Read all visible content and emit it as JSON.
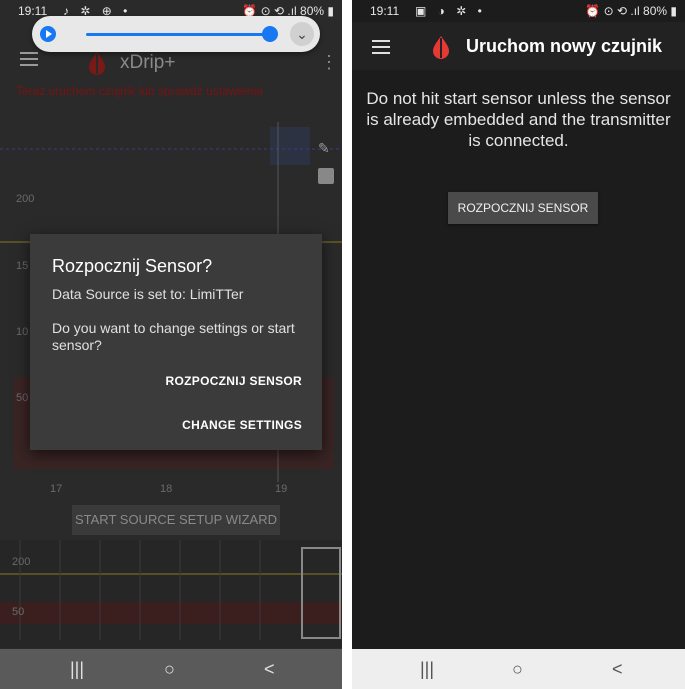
{
  "left_screen": {
    "status": {
      "time": "19:11",
      "icons": "♪ ✲ ⊕ •",
      "right": "⏰ ⊙ ⟲ .ıl 80% ▮"
    },
    "media": {
      "play_icon": "play-icon",
      "chevron_icon": "chevron-down-icon"
    },
    "app": {
      "title": "xDrip+",
      "menu_icon": "hamburger-icon",
      "overflow_icon": "overflow-menu-icon",
      "warning_text": "Teraz uruchom czujnik lub sprawdź ustawienia"
    },
    "chart": {
      "y_labels": [
        "200",
        "15",
        "10",
        "50"
      ],
      "x_labels": [
        "17",
        "18",
        "19"
      ],
      "mini_y_labels": [
        "200",
        "50"
      ]
    },
    "wizard_button": "START SOURCE SETUP WIZARD",
    "dialog": {
      "title": "Rozpocznij Sensor?",
      "line1": "Data Source is set to: LimiTTer",
      "line2": "Do you want to change settings or start sensor?",
      "button_start": "ROZPOCZNIJ SENSOR",
      "button_settings": "CHANGE SETTINGS"
    },
    "nav": {
      "recents": "|||",
      "home": "○",
      "back": "<"
    }
  },
  "right_screen": {
    "status": {
      "time": "19:11",
      "icons": "▣ ◑ ✲ •",
      "right": "⏰ ⊙ ⟲ .ıl 80% ▮"
    },
    "toolbar": {
      "title": "Uruchom nowy czujnik",
      "menu_icon": "hamburger-icon"
    },
    "message": "Do not hit start sensor unless the sensor is already embedded and the transmitter is connected.",
    "start_button": "ROZPOCZNIJ SENSOR",
    "nav": {
      "recents": "|||",
      "home": "○",
      "back": "<"
    }
  },
  "colors": {
    "accent_red": "#e53935",
    "media_blue": "#1877f2",
    "dialog_bg": "#3b3b3b"
  }
}
